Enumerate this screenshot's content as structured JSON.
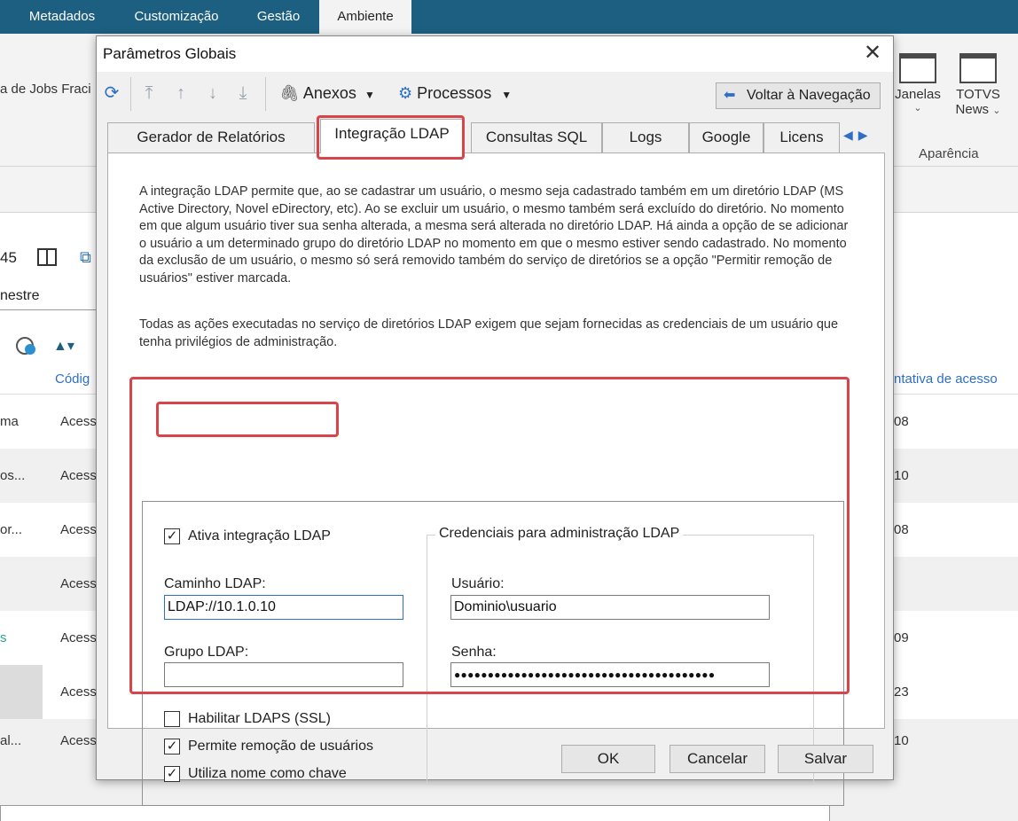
{
  "app_menu": {
    "tabs": [
      "Metadados",
      "Customização",
      "Gestão",
      "Ambiente"
    ],
    "active_tab": "Ambiente"
  },
  "ribbon": {
    "jobs_label": "a de Jobs Fraci",
    "janelas_label": "Janelas",
    "totvs_line1": "TOTVS",
    "totvs_line2": "News",
    "group_label": "Aparência"
  },
  "background_view": {
    "counter": "45",
    "filter_text": "nestre",
    "col_codigo": "Códig",
    "col_tentativa": "ntativa de acesso",
    "rows": [
      {
        "left": "ma",
        "mid": "Acess",
        "right": "08"
      },
      {
        "left": "os...",
        "mid": "Acess",
        "right": "10"
      },
      {
        "left": "or...",
        "mid": "Acess",
        "right": "08"
      },
      {
        "left": "",
        "mid": "Acess",
        "right": ""
      },
      {
        "left": "s",
        "mid": "Acess",
        "right": "09"
      },
      {
        "left": "",
        "mid": "Acess",
        "right": "23"
      },
      {
        "left": "al...",
        "mid": "Acess",
        "right": "10"
      }
    ]
  },
  "dialog": {
    "title": "Parâmetros Globais",
    "toolbar": {
      "anexos_label": "Anexos",
      "processos_label": "Processos",
      "voltar_label": "Voltar à Navegação"
    },
    "tabs": [
      "Gerador de Relatórios",
      "Integração LDAP",
      "Consultas SQL",
      "Logs",
      "Google",
      "Licens"
    ],
    "active_tab": "Integração LDAP",
    "description_1": "A integração LDAP permite que, ao se cadastrar um usuário, o mesmo seja cadastrado também em um diretório LDAP (MS Active Directory, Novel eDirectory, etc). Ao se excluir um usuário, o mesmo também será excluído do diretório. No momento em que algum usuário tiver sua senha alterada, a mesma será alterada no diretório LDAP. Há ainda a opção de se adicionar o usuário a um determinado grupo do diretório LDAP no momento em que o mesmo estiver sendo cadastrado. No momento da exclusão de um usuário, o mesmo só será removido também do serviço de diretórios se a opção \"Permitir remoção de usuários\" estiver marcada.",
    "description_2": "Todas as ações executadas no serviço de diretórios LDAP exigem que sejam fornecidas as credenciais de um usuário que tenha privilégios de administração.",
    "ativa_label": "Ativa integração LDAP",
    "ativa_checked": true,
    "caminho_label": "Caminho LDAP:",
    "caminho_value": "LDAP://10.1.0.10",
    "grupo_label": "Grupo LDAP:",
    "grupo_value": "",
    "ldaps_label": "Habilitar LDAPS (SSL)",
    "ldaps_checked": false,
    "remocao_label": "Permite remoção de usuários",
    "remocao_checked": true,
    "chave_label": "Utiliza nome como chave",
    "chave_checked": true,
    "cred_legend": "Credenciais para administração LDAP",
    "usuario_label": "Usuário:",
    "usuario_value": "Dominio\\usuario",
    "senha_label": "Senha:",
    "senha_value": "●●●●●●●●●●●●●●●●●●●●●●●●●●●●●●●●●●●●●●●",
    "buttons": {
      "ok": "OK",
      "cancel": "Cancelar",
      "save": "Salvar"
    }
  },
  "colors": {
    "accent": "#1d5f80",
    "highlight": "#d9444a",
    "link_blue": "#2e6fc4"
  }
}
